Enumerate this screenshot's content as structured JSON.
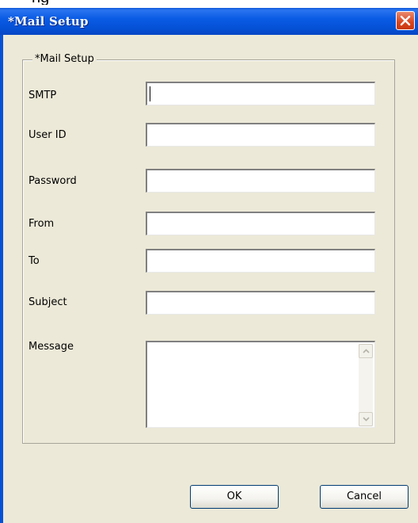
{
  "window": {
    "title": "*Mail Setup",
    "close_icon": "close-icon",
    "top_fragment": "ng"
  },
  "group": {
    "label": "*Mail Setup"
  },
  "fields": {
    "smtp": {
      "label": "SMTP",
      "value": ""
    },
    "user_id": {
      "label": "User ID",
      "value": ""
    },
    "password": {
      "label": "Password",
      "value": ""
    },
    "from": {
      "label": "From",
      "value": ""
    },
    "to": {
      "label": "To",
      "value": ""
    },
    "subject": {
      "label": "Subject",
      "value": ""
    },
    "message": {
      "label": "Message",
      "value": ""
    }
  },
  "buttons": {
    "ok": "OK",
    "cancel": "Cancel"
  },
  "colors": {
    "titlebar": "#0551d6",
    "client": "#ece9d8",
    "close": "#d9451f"
  }
}
